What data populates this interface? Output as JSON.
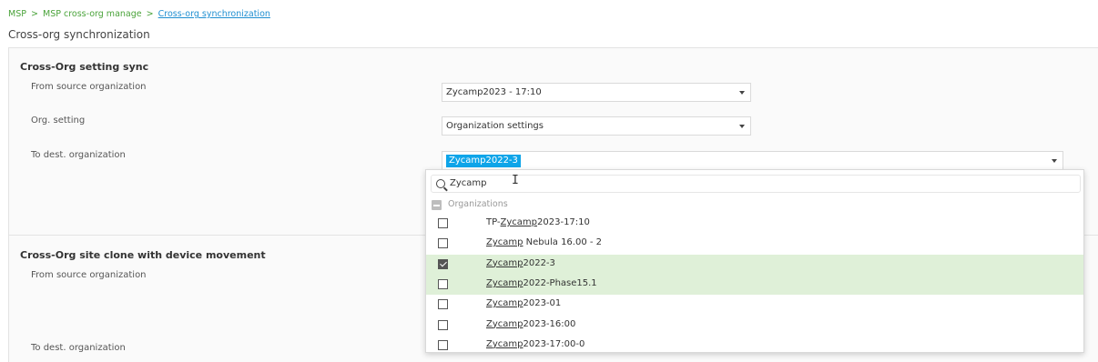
{
  "breadcrumb": {
    "item1": "MSP",
    "item2": "MSP cross-org manage",
    "current": "Cross-org synchronization",
    "separator": ">"
  },
  "page_title": "Cross-org synchronization",
  "section1": {
    "title": "Cross-Org setting sync",
    "from_label": "From source organization",
    "from_value": "Zycamp2023 - 17:10",
    "setting_label": "Org. setting",
    "setting_value": "Organization settings",
    "to_label": "To dest. organization",
    "to_selected_chip": "Zycamp2022-3"
  },
  "section2": {
    "title": "Cross-Org site clone with device movement",
    "from_label": "From source organization",
    "to_label": "To dest. organization"
  },
  "dropdown": {
    "search_value": "Zycamp",
    "group_label": "Organizations",
    "options": [
      {
        "pre": "TP-",
        "match": "Zycamp",
        "post": "2023-17:10",
        "checked": false,
        "highlighted": false
      },
      {
        "pre": "",
        "match": "Zycamp",
        "post": " Nebula 16.00 - 2",
        "checked": false,
        "highlighted": false
      },
      {
        "pre": "",
        "match": "Zycamp",
        "post": "2022-3",
        "checked": true,
        "highlighted": true
      },
      {
        "pre": "",
        "match": "Zycamp",
        "post": "2022-Phase15.1",
        "checked": false,
        "highlighted": true
      },
      {
        "pre": "",
        "match": "Zycamp",
        "post": "2023-01",
        "checked": false,
        "highlighted": false
      },
      {
        "pre": "",
        "match": "Zycamp",
        "post": "2023-16:00",
        "checked": false,
        "highlighted": false
      },
      {
        "pre": "",
        "match": "Zycamp",
        "post": "2023-17:00-0",
        "checked": false,
        "highlighted": false
      }
    ]
  },
  "colors": {
    "breadcrumb": "#4aa33a",
    "link": "#1f8fd1",
    "chip": "#0ea5e9",
    "selected_row": "#dff0d8"
  }
}
